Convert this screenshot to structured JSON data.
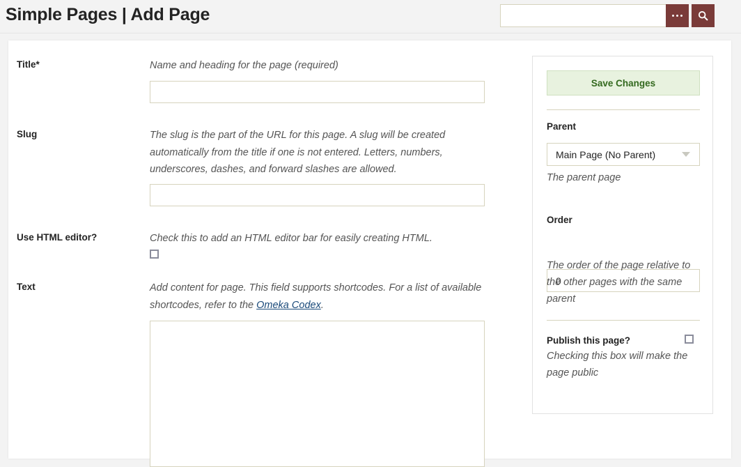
{
  "header": {
    "title": "Simple Pages | Add Page",
    "search": {
      "value": "",
      "placeholder": ""
    },
    "options_icon": "ellipsis-icon",
    "search_icon": "search-icon"
  },
  "form": {
    "fields": [
      {
        "label": "Title*",
        "description": "Name and heading for the page (required)",
        "value": "",
        "type": "text"
      },
      {
        "label": "Slug",
        "description": "The slug is the part of the URL for this page. A slug will be created automatically from the title if one is not entered. Letters, numbers, underscores, dashes, and forward slashes are allowed.",
        "value": "",
        "type": "text"
      },
      {
        "label": "Use HTML editor?",
        "description": "Check this to add an HTML editor bar for easily creating HTML.",
        "checked": false,
        "type": "checkbox"
      },
      {
        "label": "Text",
        "description_part1": "Add content for page. This field supports shortcodes. For a list of available shortcodes, refer to the ",
        "link_text": "Omeka Codex",
        "description_part2": ".",
        "value": "",
        "type": "textarea"
      }
    ]
  },
  "sidebar": {
    "save_label": "Save Changes",
    "parent_label": "Parent",
    "parent_value": "Main Page (No Parent)",
    "parent_description": "The parent page",
    "parent_arrow_icon": "chevron-down-icon",
    "order_label": "Order",
    "order_value": "0",
    "order_description": "The order of the page relative to the other pages with the same parent",
    "publish_label": "Publish this page?",
    "publish_description": "Checking this box will make the page public",
    "publish_checked": false
  },
  "colors": {
    "accent_brick": "#7a3b39",
    "save_bg": "#e8f2df",
    "save_text": "#33691e",
    "input_border": "#d6d3bd",
    "link": "#1a4a7a",
    "page_bg": "#f3f3f3"
  }
}
